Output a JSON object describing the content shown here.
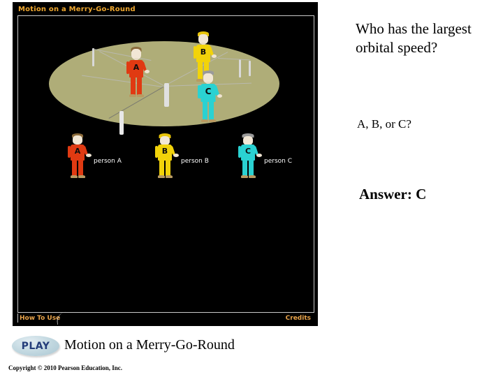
{
  "media_panel": {
    "title": "Motion on a Merry-Go-Round",
    "how_to_use_label": "How To Use",
    "credits_label": "Credits",
    "platform_color": "#afad78",
    "background_color": "#000000",
    "accent_color": "#e8a34a",
    "people": [
      {
        "id": "A",
        "letter": "A",
        "label": "person A",
        "color": "#e03a12",
        "hair_color": "#8a6a3a",
        "on_platform": true
      },
      {
        "id": "B",
        "letter": "B",
        "label": "person B",
        "color": "#f2d30a",
        "hair_color": "#e8c40a",
        "on_platform": true
      },
      {
        "id": "C",
        "letter": "C",
        "label": "person C",
        "color": "#2ad2d2",
        "hair_color": "#9a9a9a",
        "on_platform": true
      }
    ],
    "legend": [
      {
        "letter": "A",
        "label": "person A",
        "color": "#e03a12",
        "hair_color": "#8a6a3a"
      },
      {
        "letter": "B",
        "label": "person B",
        "color": "#f2d30a",
        "hair_color": "#e8c40a"
      },
      {
        "letter": "C",
        "label": "person C",
        "color": "#2ad2d2",
        "hair_color": "#9a9a9a"
      }
    ]
  },
  "play_row": {
    "play_label": "PLAY",
    "caption": "Motion on a Merry-Go-Round"
  },
  "copyright": "Copyright © 2010 Pearson Education, Inc.",
  "content": {
    "question": "Who has the largest orbital speed?",
    "choices": "A, B, or C?",
    "answer": "Answer: C"
  }
}
